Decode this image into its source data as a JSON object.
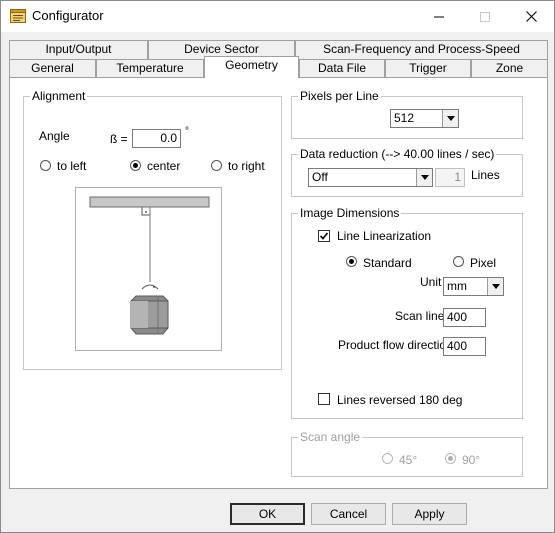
{
  "window": {
    "title": "Configurator",
    "icon": "configurator-app-icon",
    "min_icon": "minimize-icon",
    "max_icon": "maximize-icon",
    "close_icon": "close-icon"
  },
  "tabs_row1": [
    {
      "label": "Input/Output"
    },
    {
      "label": "Device Sector"
    },
    {
      "label": "Scan-Frequency and Process-Speed"
    }
  ],
  "tabs_row2": [
    {
      "label": "General"
    },
    {
      "label": "Temperature"
    },
    {
      "label": "Geometry",
      "active": true
    },
    {
      "label": "Data File"
    },
    {
      "label": "Trigger"
    },
    {
      "label": "Zone"
    }
  ],
  "alignment": {
    "legend": "Alignment",
    "angle_label": "Angle",
    "beta_label": "ß =",
    "angle_value": "0.0",
    "degree_symbol": "°",
    "options": [
      {
        "label": "to left",
        "checked": false
      },
      {
        "label": "center",
        "checked": true
      },
      {
        "label": "to right",
        "checked": false
      }
    ]
  },
  "pixels_per_line": {
    "legend": "Pixels per Line",
    "value": "512"
  },
  "data_reduction": {
    "legend": "Data reduction (--> 40.00 lines / sec)",
    "value": "Off",
    "lines_value": "1",
    "lines_label": "Lines"
  },
  "image_dimensions": {
    "legend": "Image Dimensions",
    "line_linearization_label": "Line Linearization",
    "line_linearization_checked": true,
    "standard_label": "Standard",
    "standard_checked": true,
    "pixel_label": "Pixel",
    "pixel_checked": false,
    "unit_label": "Unit",
    "unit_value": "mm",
    "scan_line_label": "Scan line",
    "scan_line_value": "400",
    "product_flow_label": "Product flow direction",
    "product_flow_value": "400",
    "lines_reversed_label": "Lines reversed 180 deg",
    "lines_reversed_checked": false
  },
  "scan_angle": {
    "legend": "Scan angle",
    "opt45_label": "45°",
    "opt90_label": "90°",
    "opt90_checked": true
  },
  "buttons": {
    "ok": "OK",
    "cancel": "Cancel",
    "apply": "Apply"
  },
  "colors": {
    "title_bg": "#ffffff",
    "dialog_bg": "#f0f0f0",
    "panel_bg": "#ffffff",
    "border": "#a0a0a0",
    "disabled_text": "#a0a0a0"
  }
}
